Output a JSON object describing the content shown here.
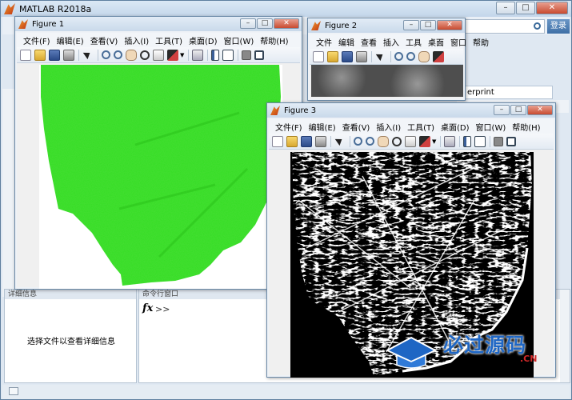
{
  "main": {
    "title": "MATLAB R2018a",
    "login_label": "登录",
    "path_text": "erprint",
    "details": {
      "message": "选择文件以查看详细信息",
      "header": "详细信息"
    },
    "command": {
      "header": "命令行窗口",
      "prompt": "fx >>"
    }
  },
  "figure_menu": [
    "文件(F)",
    "编辑(E)",
    "查看(V)",
    "插入(I)",
    "工具(T)",
    "桌面(D)",
    "窗口(W)",
    "帮助(H)"
  ],
  "figure_menu_short": [
    "文件",
    "编辑",
    "查看",
    "插入",
    "工具",
    "桌面",
    "窗口",
    "帮助"
  ],
  "figures": [
    {
      "title": "Figure 1"
    },
    {
      "title": "Figure 2"
    },
    {
      "title": "Figure 3"
    }
  ],
  "watermark": {
    "text": "必过源码",
    "sub": ".CN"
  },
  "colors": {
    "green_region": "#33dd22",
    "binary_fg": "#ffffff",
    "binary_bg": "#000000",
    "title_accent": "#1e66c4"
  }
}
